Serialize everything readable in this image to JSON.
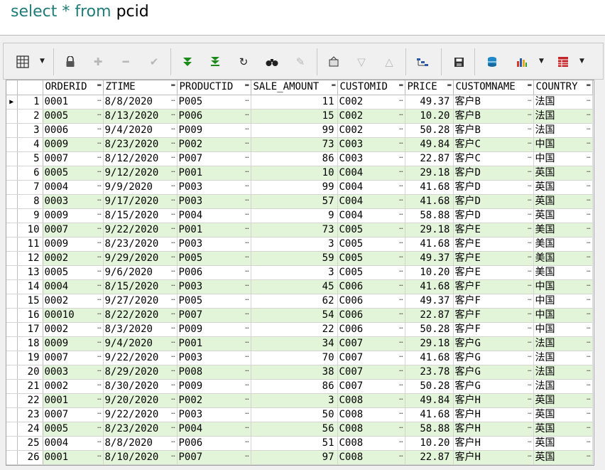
{
  "editor": {
    "kw1": "select",
    "star": "*",
    "kw2": "from",
    "table": "pcid"
  },
  "toolbar": {
    "buttons": [
      "grid-view-icon",
      "lock-icon",
      "add-icon",
      "remove-icon",
      "check-icon",
      "first-record-icon",
      "last-record-icon",
      "refresh-icon",
      "find-icon",
      "clear-icon",
      "export-icon",
      "sort-down-icon",
      "sort-up-icon",
      "filter-icon",
      "save-icon",
      "database-icon",
      "chart-icon",
      "table-icon"
    ]
  },
  "grid": {
    "columns": [
      "ORDERID",
      "ZTIME",
      "PRODUCTID",
      "SALE_AMOUNT",
      "CUSTOMID",
      "PRICE",
      "CUSTOMNAME",
      "COUNTRY"
    ],
    "rows": [
      [
        "1",
        "0001",
        "8/8/2020",
        "P005",
        "11",
        "C002",
        "49.37",
        "客户B",
        "法国"
      ],
      [
        "2",
        "0005",
        "8/13/2020",
        "P006",
        "15",
        "C002",
        "10.20",
        "客户B",
        "法国"
      ],
      [
        "3",
        "0006",
        "9/4/2020",
        "P009",
        "99",
        "C002",
        "50.28",
        "客户B",
        "法国"
      ],
      [
        "4",
        "0009",
        "8/23/2020",
        "P002",
        "73",
        "C003",
        "49.84",
        "客户C",
        "中国"
      ],
      [
        "5",
        "0007",
        "8/12/2020",
        "P007",
        "86",
        "C003",
        "22.87",
        "客户C",
        "中国"
      ],
      [
        "6",
        "0005",
        "9/12/2020",
        "P001",
        "10",
        "C004",
        "29.18",
        "客户D",
        "英国"
      ],
      [
        "7",
        "0004",
        "9/9/2020",
        "P003",
        "99",
        "C004",
        "41.68",
        "客户D",
        "英国"
      ],
      [
        "8",
        "0003",
        "9/17/2020",
        "P003",
        "57",
        "C004",
        "41.68",
        "客户D",
        "英国"
      ],
      [
        "9",
        "0009",
        "8/15/2020",
        "P004",
        "9",
        "C004",
        "58.88",
        "客户D",
        "英国"
      ],
      [
        "10",
        "0007",
        "9/22/2020",
        "P001",
        "73",
        "C005",
        "29.18",
        "客户E",
        "美国"
      ],
      [
        "11",
        "0009",
        "8/23/2020",
        "P003",
        "3",
        "C005",
        "41.68",
        "客户E",
        "美国"
      ],
      [
        "12",
        "0002",
        "9/29/2020",
        "P005",
        "59",
        "C005",
        "49.37",
        "客户E",
        "美国"
      ],
      [
        "13",
        "0005",
        "9/6/2020",
        "P006",
        "3",
        "C005",
        "10.20",
        "客户E",
        "美国"
      ],
      [
        "14",
        "0004",
        "8/15/2020",
        "P003",
        "45",
        "C006",
        "41.68",
        "客户F",
        "中国"
      ],
      [
        "15",
        "0002",
        "9/27/2020",
        "P005",
        "62",
        "C006",
        "49.37",
        "客户F",
        "中国"
      ],
      [
        "16",
        "00010",
        "8/22/2020",
        "P007",
        "54",
        "C006",
        "22.87",
        "客户F",
        "中国"
      ],
      [
        "17",
        "0002",
        "8/3/2020",
        "P009",
        "22",
        "C006",
        "50.28",
        "客户F",
        "中国"
      ],
      [
        "18",
        "0009",
        "9/4/2020",
        "P001",
        "34",
        "C007",
        "29.18",
        "客户G",
        "法国"
      ],
      [
        "19",
        "0007",
        "9/22/2020",
        "P003",
        "70",
        "C007",
        "41.68",
        "客户G",
        "法国"
      ],
      [
        "20",
        "0003",
        "8/29/2020",
        "P008",
        "38",
        "C007",
        "23.78",
        "客户G",
        "法国"
      ],
      [
        "21",
        "0002",
        "8/30/2020",
        "P009",
        "86",
        "C007",
        "50.28",
        "客户G",
        "法国"
      ],
      [
        "22",
        "0001",
        "9/20/2020",
        "P002",
        "3",
        "C008",
        "49.84",
        "客户H",
        "英国"
      ],
      [
        "23",
        "0007",
        "9/22/2020",
        "P003",
        "50",
        "C008",
        "41.68",
        "客户H",
        "英国"
      ],
      [
        "24",
        "0005",
        "8/23/2020",
        "P004",
        "56",
        "C008",
        "58.88",
        "客户H",
        "英国"
      ],
      [
        "25",
        "0004",
        "8/8/2020",
        "P006",
        "51",
        "C008",
        "10.20",
        "客户H",
        "英国"
      ],
      [
        "26",
        "0001",
        "8/10/2020",
        "P007",
        "97",
        "C008",
        "22.87",
        "客户H",
        "英国"
      ]
    ]
  },
  "colors": {
    "alt_row": "#e3f5d8",
    "keyword": "#1f7c79"
  }
}
